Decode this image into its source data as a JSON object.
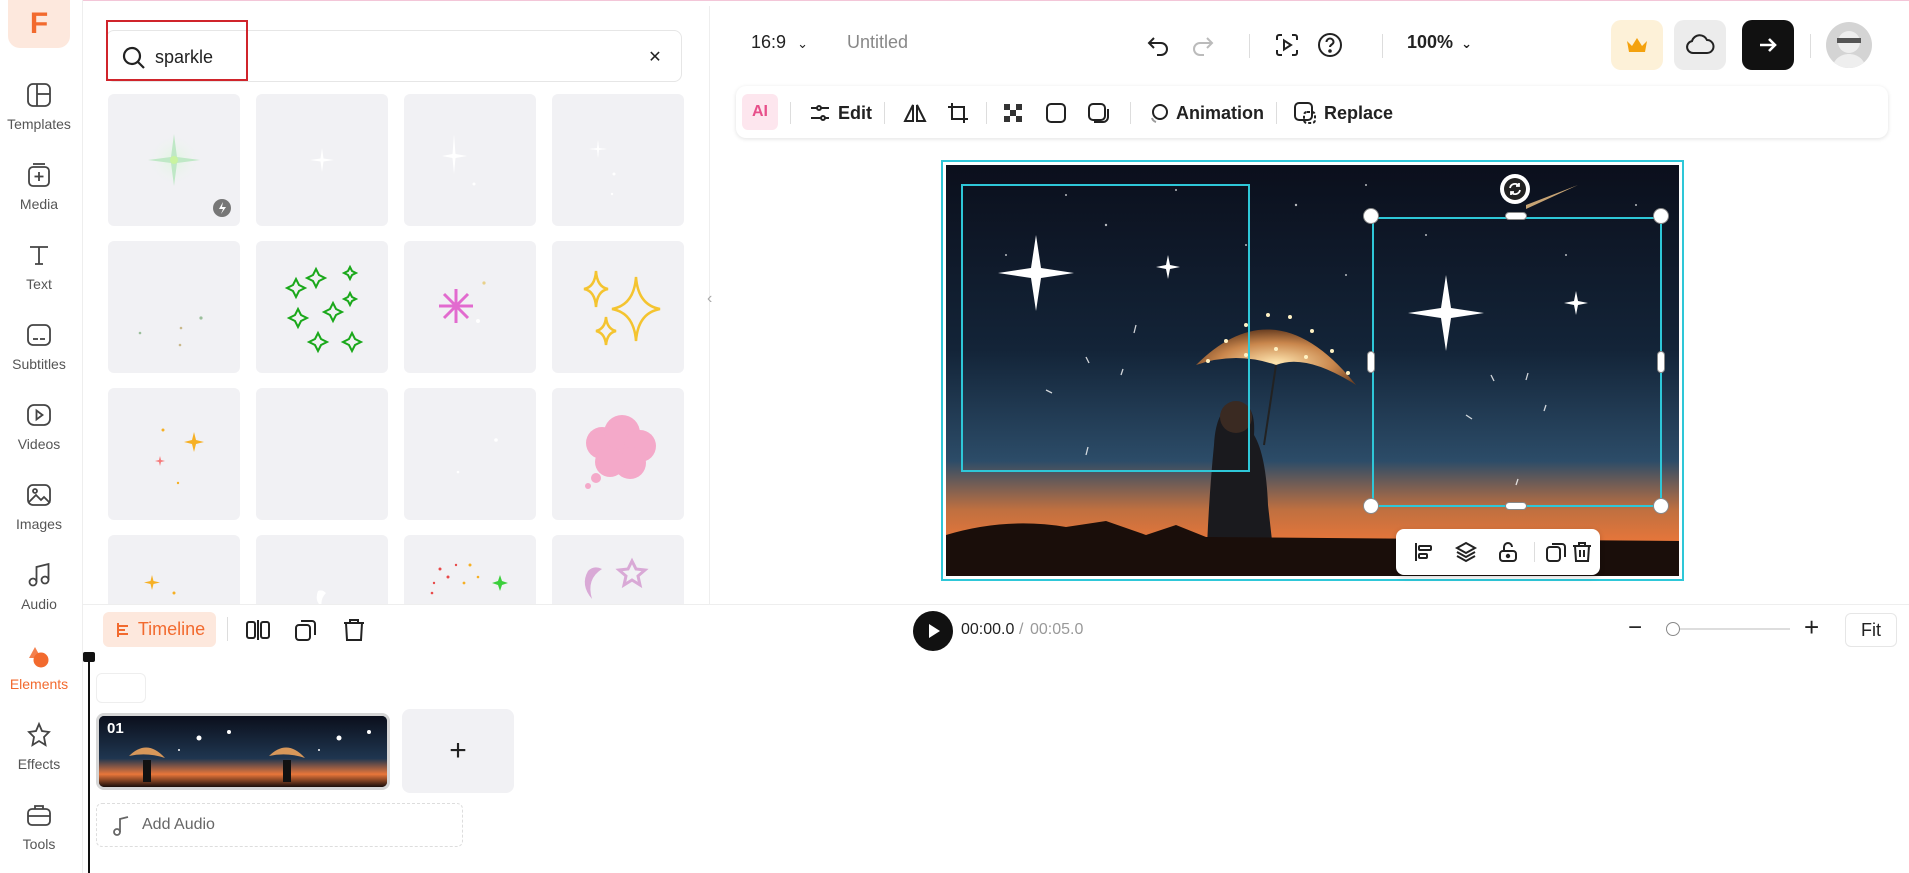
{
  "nav": {
    "items": [
      {
        "label": "Templates",
        "icon": "templates-icon"
      },
      {
        "label": "Media",
        "icon": "media-icon"
      },
      {
        "label": "Text",
        "icon": "text-icon"
      },
      {
        "label": "Subtitles",
        "icon": "subtitles-icon"
      },
      {
        "label": "Videos",
        "icon": "videos-icon"
      },
      {
        "label": "Images",
        "icon": "images-icon"
      },
      {
        "label": "Audio",
        "icon": "audio-icon"
      },
      {
        "label": "Elements",
        "icon": "elements-icon"
      },
      {
        "label": "Effects",
        "icon": "effects-icon"
      },
      {
        "label": "Tools",
        "icon": "tools-icon"
      }
    ],
    "active": "Elements",
    "accent_color": "#f26a2e"
  },
  "search": {
    "query": "sparkle",
    "highlight_color": "#d0242b"
  },
  "topbar": {
    "aspect_ratio": "16:9",
    "title": "Untitled",
    "zoom": "100%"
  },
  "element_toolbar": {
    "ai_label": "AI",
    "edit_label": "Edit",
    "animation_label": "Animation",
    "replace_label": "Replace"
  },
  "timeline": {
    "tab_label": "Timeline",
    "current_time": "00:00.0",
    "separator": "/",
    "total_time": "00:05.0",
    "fit_label": "Fit",
    "clip_number": "01",
    "add_audio_label": "Add Audio"
  },
  "colors": {
    "selection": "#2ec7d8",
    "export_button": "#111111",
    "premium_bg": "#fdf1d8"
  }
}
